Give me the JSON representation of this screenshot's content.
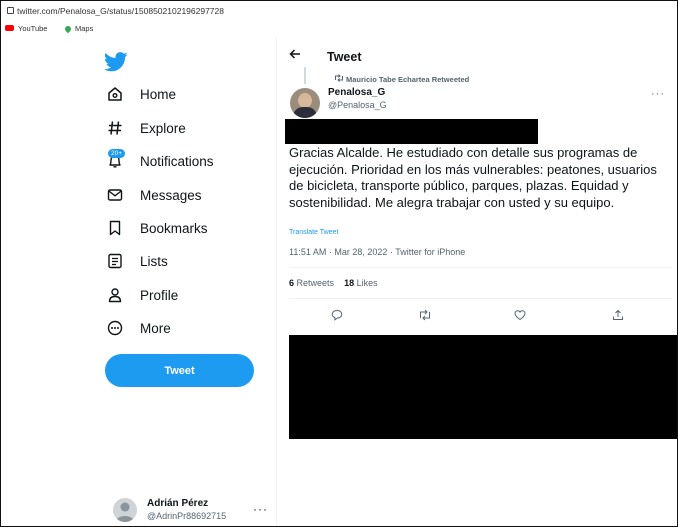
{
  "browser": {
    "url": "twitter.com/Penalosa_G/status/1508502102196297728",
    "bookmarks": [
      {
        "label": "YouTube"
      },
      {
        "label": "Maps"
      }
    ]
  },
  "sidebar": {
    "logo": "twitter-bird-icon",
    "items": [
      {
        "label": "Home",
        "icon": "home-icon"
      },
      {
        "label": "Explore",
        "icon": "hashtag-icon"
      },
      {
        "label": "Notifications",
        "icon": "bell-icon",
        "badge": "20+"
      },
      {
        "label": "Messages",
        "icon": "envelope-icon"
      },
      {
        "label": "Bookmarks",
        "icon": "bookmark-icon"
      },
      {
        "label": "Lists",
        "icon": "list-icon"
      },
      {
        "label": "Profile",
        "icon": "person-icon"
      },
      {
        "label": "More",
        "icon": "more-circle-icon"
      }
    ],
    "tweet_button": "Tweet",
    "account": {
      "name": "Adrián Pérez",
      "handle": "@AdrinPr88692715",
      "more": "···"
    }
  },
  "main": {
    "header_title": "Tweet",
    "retweeted_by": "Mauricio Tabe Echartea Retweeted",
    "author": {
      "name": "Penalosa_G",
      "handle": "@Penalosa_G"
    },
    "text": "Gracias Alcalde. He estudiado con detalle sus programas de ejecución. Prioridad en los más vulnerables: peatones, usuarios de bicicleta, transporte público, parques, plazas. Equidad y sostenibilidad. Me alegra trabajar con usted y su equipo.",
    "translate_label": "Translate Tweet",
    "meta": "11:51 AM · Mar 28, 2022 · Twitter for iPhone",
    "stats": {
      "retweets_count": "6",
      "retweets_label": "Retweets",
      "likes_count": "18",
      "likes_label": "Likes"
    }
  },
  "colors": {
    "accent": "#1d9bf0",
    "text": "#0f1419",
    "muted": "#536471",
    "redaction": "#000000"
  }
}
